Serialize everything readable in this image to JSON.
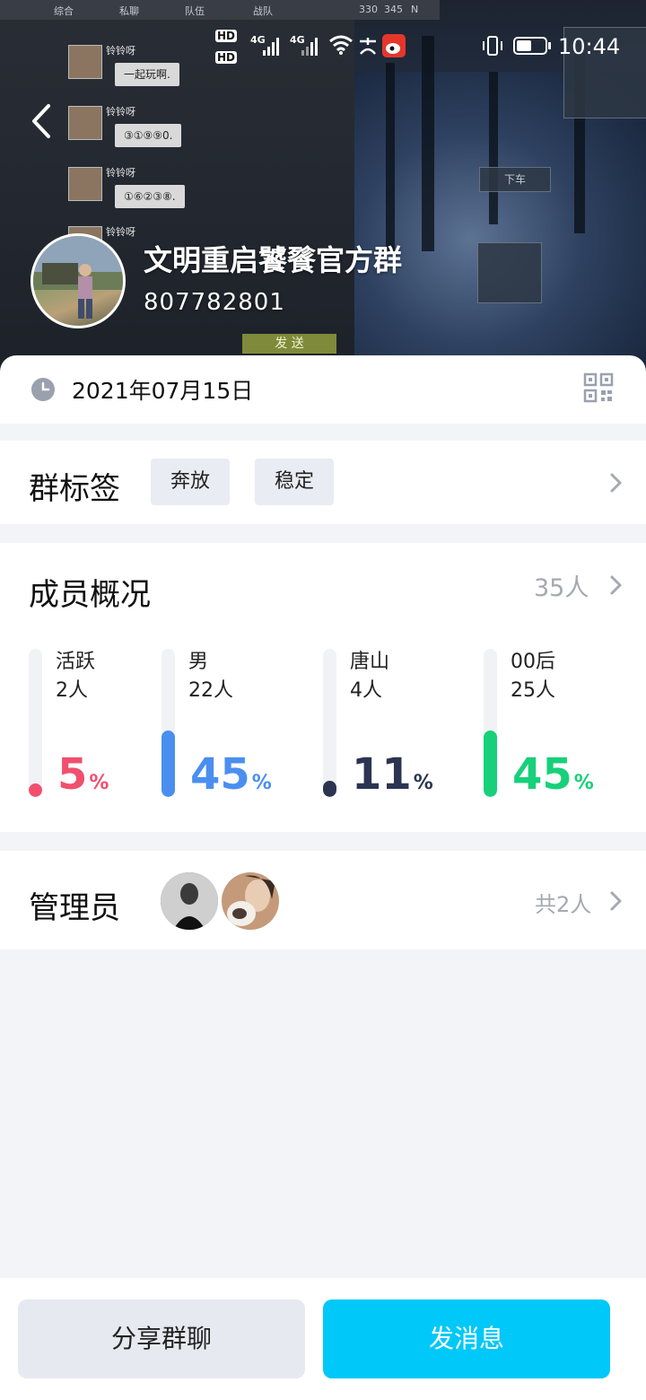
{
  "status_bar": {
    "hd1": "HD",
    "hd2": "HD",
    "net1": "4G",
    "net2": "4G",
    "time": "10:44"
  },
  "game_overlay": {
    "tabs": [
      "综合",
      "私聊",
      "队伍",
      "战队"
    ],
    "coords": [
      "330",
      "345",
      "N"
    ],
    "chat": [
      {
        "name": "铃铃呀",
        "message": "一起玩啊."
      },
      {
        "name": "铃铃呀",
        "message": "③①⑨⑨0."
      },
      {
        "name": "铃铃呀",
        "message": "①⑥②③⑧."
      },
      {
        "name": "铃铃呀",
        "message": ""
      }
    ],
    "send_label": "发 送",
    "get_off_label": "下车"
  },
  "group": {
    "name": "文明重启饕餮官方群",
    "id": "807782801",
    "created_date": "2021年07月15日"
  },
  "tags_section": {
    "title": "群标签",
    "tags": [
      "奔放",
      "稳定"
    ]
  },
  "members_section": {
    "title": "成员概况",
    "total": "35人",
    "stats": [
      {
        "label": "活跃",
        "count": "2人",
        "percent": "5",
        "unit": "%",
        "fraction": 0.05,
        "color": "#f0506e"
      },
      {
        "label": "男",
        "count": "22人",
        "percent": "45",
        "unit": "%",
        "fraction": 0.45,
        "color": "#4a8ff0"
      },
      {
        "label": "唐山",
        "count": "4人",
        "percent": "11",
        "unit": "%",
        "fraction": 0.11,
        "color": "#2b3552"
      },
      {
        "label": "00后",
        "count": "25人",
        "percent": "45",
        "unit": "%",
        "fraction": 0.45,
        "color": "#18d07a"
      }
    ]
  },
  "admins_section": {
    "title": "管理员",
    "total": "共2人"
  },
  "buttons": {
    "share": "分享群聊",
    "send": "发消息"
  },
  "colors": {
    "accent": "#00c8f8",
    "page_bg": "#f3f4f8",
    "muted": "#a6a9b0"
  }
}
